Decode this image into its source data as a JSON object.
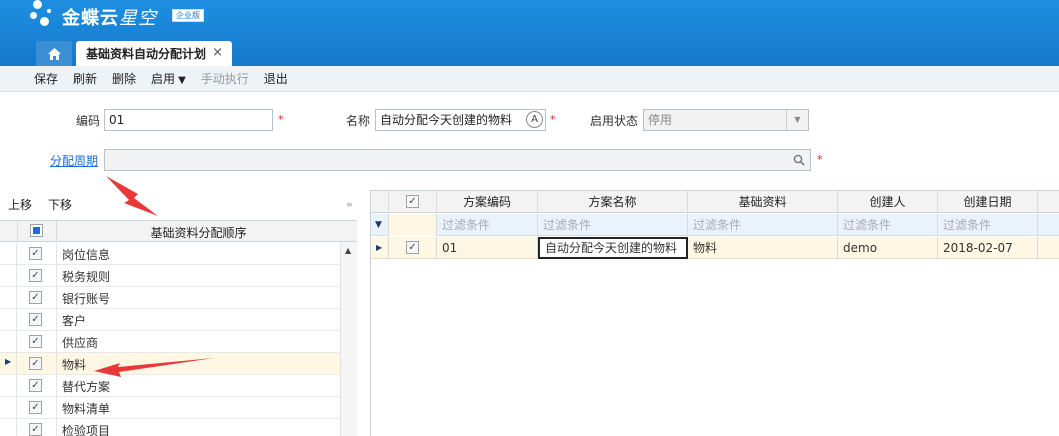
{
  "header": {
    "brand_main": "金蝶云",
    "brand_sub": "星空",
    "edition": "企业版",
    "home_icon": "home-icon",
    "active_tab": "基础资料自动分配计划",
    "tab_close": "×"
  },
  "toolbar": {
    "save": "保存",
    "refresh": "刷新",
    "delete": "删除",
    "enable": "启用",
    "manual_run": "手动执行",
    "exit": "退出"
  },
  "form": {
    "code_label": "编码",
    "code_value": "01",
    "name_label": "名称",
    "name_value": "自动分配今天创建的物料",
    "status_label": "启用状态",
    "status_value": "停用",
    "period_label": "分配周期",
    "period_value": "",
    "required_mark": "*"
  },
  "left_grid": {
    "move_up": "上移",
    "move_down": "下移",
    "header": "基础资料分配顺序",
    "rows": [
      "岗位信息",
      "税务规则",
      "银行账号",
      "客户",
      "供应商",
      "物料",
      "替代方案",
      "物料清单",
      "检验项目"
    ],
    "selected_row_index": 5
  },
  "right_grid": {
    "columns": [
      "方案编码",
      "方案名称",
      "基础资料",
      "创建人",
      "创建日期"
    ],
    "filter_placeholder": "过滤条件",
    "rows": [
      {
        "code": "01",
        "name": "自动分配今天创建的物料",
        "basedata": "物料",
        "creator": "demo",
        "date": "2018-02-07"
      }
    ]
  },
  "colors": {
    "header_blue": "#1478cc",
    "required_red": "#e02020",
    "link_blue": "#1a6dd6",
    "annotation_arrow": "#e8393a"
  }
}
